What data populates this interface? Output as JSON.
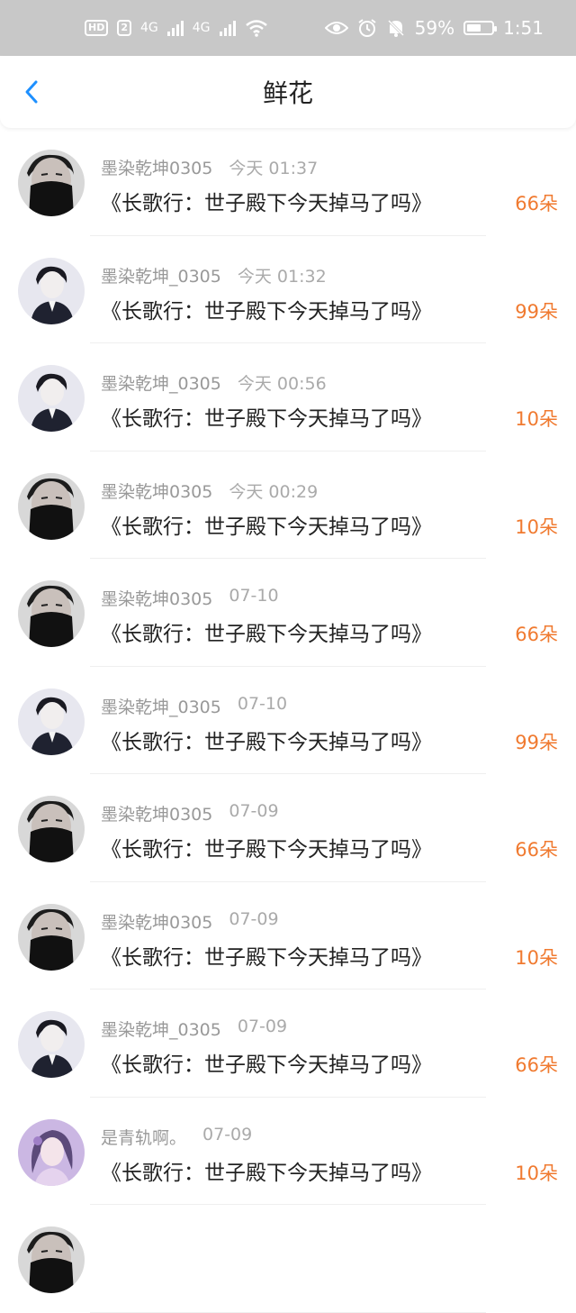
{
  "status": {
    "badge1": "HD",
    "badge2": "2",
    "net1": "4G",
    "net2": "4G",
    "battery_percent": "59%",
    "battery_level": 0.59,
    "time": "1:51",
    "icons": [
      "eye-icon",
      "alarm-icon",
      "mute-bell-icon",
      "wifi-icon"
    ]
  },
  "header": {
    "title": "鲜花"
  },
  "rows": [
    {
      "user": "墨染乾坤0305",
      "time": "今天 01:37",
      "book": "《长歌行：世子殿下今天掉马了吗》",
      "count": "66朵",
      "avatar": "mask"
    },
    {
      "user": "墨染乾坤_0305",
      "time": "今天 01:32",
      "book": "《长歌行：世子殿下今天掉马了吗》",
      "count": "99朵",
      "avatar": "suit"
    },
    {
      "user": "墨染乾坤_0305",
      "time": "今天 00:56",
      "book": "《长歌行：世子殿下今天掉马了吗》",
      "count": "10朵",
      "avatar": "suit"
    },
    {
      "user": "墨染乾坤0305",
      "time": "今天 00:29",
      "book": "《长歌行：世子殿下今天掉马了吗》",
      "count": "10朵",
      "avatar": "mask"
    },
    {
      "user": "墨染乾坤0305",
      "time": "07-10",
      "book": "《长歌行：世子殿下今天掉马了吗》",
      "count": "66朵",
      "avatar": "mask"
    },
    {
      "user": "墨染乾坤_0305",
      "time": "07-10",
      "book": "《长歌行：世子殿下今天掉马了吗》",
      "count": "99朵",
      "avatar": "suit"
    },
    {
      "user": "墨染乾坤0305",
      "time": "07-09",
      "book": "《长歌行：世子殿下今天掉马了吗》",
      "count": "66朵",
      "avatar": "mask"
    },
    {
      "user": "墨染乾坤0305",
      "time": "07-09",
      "book": "《长歌行：世子殿下今天掉马了吗》",
      "count": "10朵",
      "avatar": "mask"
    },
    {
      "user": "墨染乾坤_0305",
      "time": "07-09",
      "book": "《长歌行：世子殿下今天掉马了吗》",
      "count": "66朵",
      "avatar": "suit"
    },
    {
      "user": "是青轨啊。",
      "time": "07-09",
      "book": "《长歌行：世子殿下今天掉马了吗》",
      "count": "10朵",
      "avatar": "girl"
    },
    {
      "user": "",
      "time": "",
      "book": "",
      "count": "",
      "avatar": "mask"
    }
  ],
  "colors": {
    "accent": "#f07a30",
    "back": "#1e90ff",
    "statusbar": "#c8c8c8"
  }
}
